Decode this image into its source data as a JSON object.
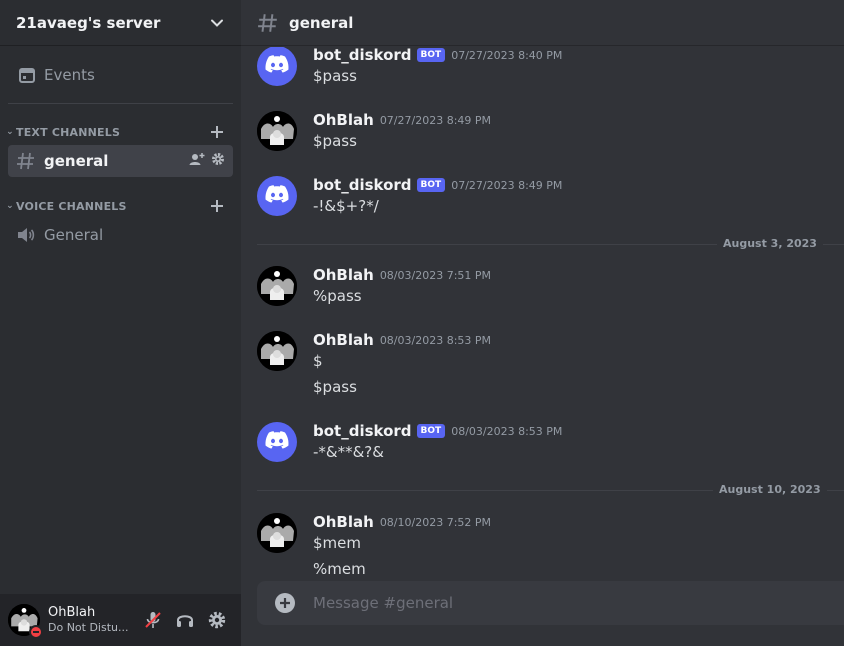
{
  "server": {
    "name": "21avaeg's server"
  },
  "sidebar": {
    "events_label": "Events",
    "categories": {
      "text": "TEXT CHANNELS",
      "voice": "VOICE CHANNELS"
    },
    "text_channels": [
      {
        "name": "general",
        "active": true
      }
    ],
    "voice_channels": [
      {
        "name": "General"
      }
    ]
  },
  "user_panel": {
    "username": "OhBlah",
    "status": "Do Not Distu..."
  },
  "channel": {
    "name": "general"
  },
  "messages": [
    {
      "author": "bot_diskord",
      "bot": true,
      "bot_tag": "BOT",
      "time": "07/27/2023 8:40 PM",
      "lines": [
        "$pass"
      ]
    },
    {
      "author": "OhBlah",
      "bot": false,
      "time": "07/27/2023 8:49 PM",
      "lines": [
        "$pass"
      ]
    },
    {
      "author": "bot_diskord",
      "bot": true,
      "bot_tag": "BOT",
      "time": "07/27/2023 8:49 PM",
      "lines": [
        "-!&$+?*/"
      ]
    },
    {
      "author": "OhBlah",
      "bot": false,
      "time": "08/03/2023 7:51 PM",
      "lines": [
        "%pass"
      ]
    },
    {
      "author": "OhBlah",
      "bot": false,
      "time": "08/03/2023 8:53 PM",
      "lines": [
        "$",
        "$pass"
      ]
    },
    {
      "author": "bot_diskord",
      "bot": true,
      "bot_tag": "BOT",
      "time": "08/03/2023 8:53 PM",
      "lines": [
        "-*&**&?&"
      ]
    },
    {
      "author": "OhBlah",
      "bot": false,
      "time": "08/10/2023 7:52 PM",
      "lines": [
        "$mem",
        "%mem"
      ]
    }
  ],
  "date_dividers": [
    "August 3, 2023",
    "August 10, 2023"
  ],
  "composer": {
    "placeholder": "Message #general"
  },
  "icons": {
    "server_menu": "chevron-down-icon",
    "events": "calendar-icon",
    "category_collapse": "chevron-down-icon",
    "create_channel": "plus-icon",
    "text_channel": "hash-icon",
    "invite": "add-user-icon",
    "channel_settings": "gear-icon",
    "voice_channel": "speaker-icon",
    "mute": "microphone-muted-icon",
    "deafen": "headphones-icon",
    "user_settings": "gear-icon",
    "bot_avatar": "discord-logo-icon",
    "upload": "plus-circle-icon"
  },
  "colors": {
    "blurple": "#5865f2",
    "dnd_red": "#f23f43",
    "muted_red": "#f23f43"
  }
}
